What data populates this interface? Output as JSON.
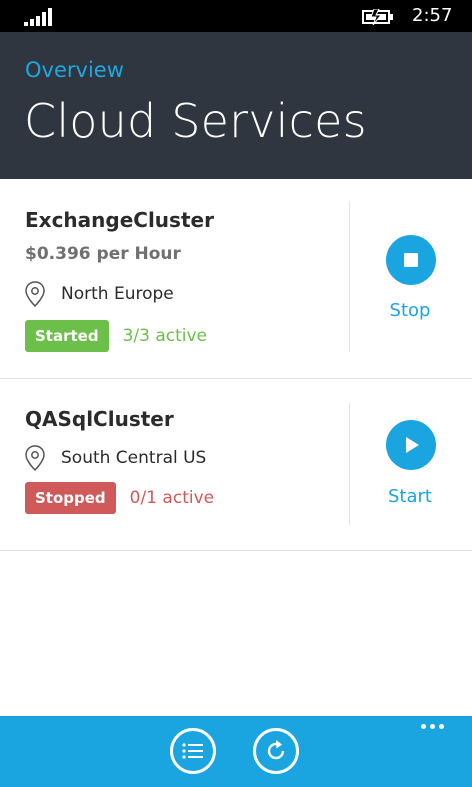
{
  "status_bar": {
    "time": "2:57",
    "signal_icon": "signal-icon",
    "battery_icon": "battery-charging-icon"
  },
  "header": {
    "subtitle": "Overview",
    "title": "Cloud Services"
  },
  "services": [
    {
      "name": "ExchangeCluster",
      "price": "$0.396 per Hour",
      "location": "North Europe",
      "status": "Started",
      "active": "3/3 active",
      "action": "Stop",
      "status_color": "#6cc04a",
      "action_icon": "stop-icon"
    },
    {
      "name": "QASqlCluster",
      "location": "South Central US",
      "status": "Stopped",
      "active": "0/1 active",
      "action": "Start",
      "status_color": "#d05a5a",
      "action_icon": "play-icon"
    }
  ],
  "app_bar": {
    "buttons": [
      {
        "icon": "list-icon"
      },
      {
        "icon": "refresh-icon"
      }
    ],
    "more_icon": "more-icon",
    "accent": "#1ba5e0"
  },
  "colors": {
    "header_bg": "#2f363f",
    "accent": "#1ba5e0"
  }
}
